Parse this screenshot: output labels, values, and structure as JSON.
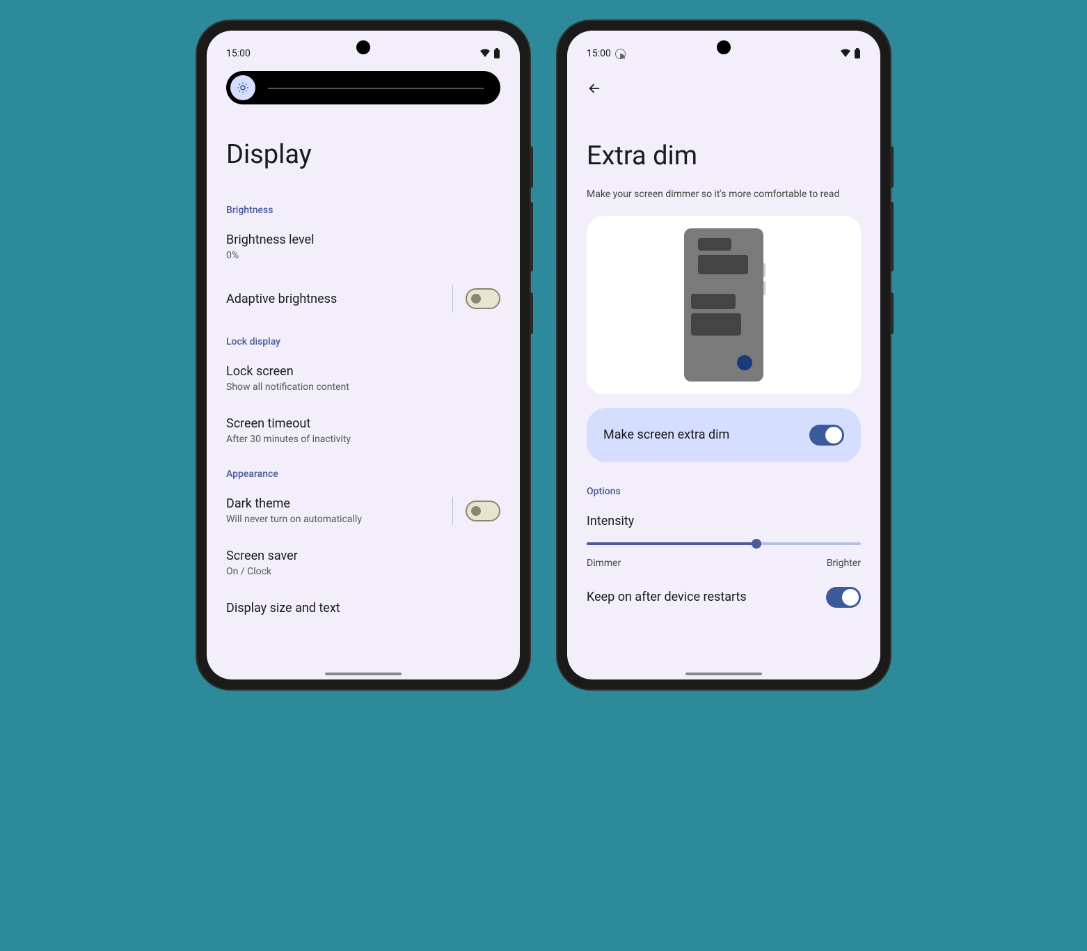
{
  "status": {
    "time": "15:00"
  },
  "screen1": {
    "title": "Display",
    "sections": {
      "brightness": {
        "header": "Brightness",
        "level": {
          "title": "Brightness level",
          "value": "0%"
        },
        "adaptive": {
          "title": "Adaptive brightness"
        }
      },
      "lock": {
        "header": "Lock display",
        "lockscreen": {
          "title": "Lock screen",
          "sub": "Show all notification content"
        },
        "timeout": {
          "title": "Screen timeout",
          "sub": "After 30 minutes of inactivity"
        }
      },
      "appearance": {
        "header": "Appearance",
        "dark": {
          "title": "Dark theme",
          "sub": "Will never turn on automatically"
        },
        "saver": {
          "title": "Screen saver",
          "sub": "On / Clock"
        },
        "size": {
          "title": "Display size and text"
        }
      }
    }
  },
  "screen2": {
    "title": "Extra dim",
    "desc": "Make your screen dimmer so it's more comfortable to read",
    "mainToggle": "Make screen extra dim",
    "optionsHeader": "Options",
    "intensity": {
      "title": "Intensity",
      "min": "Dimmer",
      "max": "Brighter"
    },
    "keep": "Keep on after device restarts"
  }
}
